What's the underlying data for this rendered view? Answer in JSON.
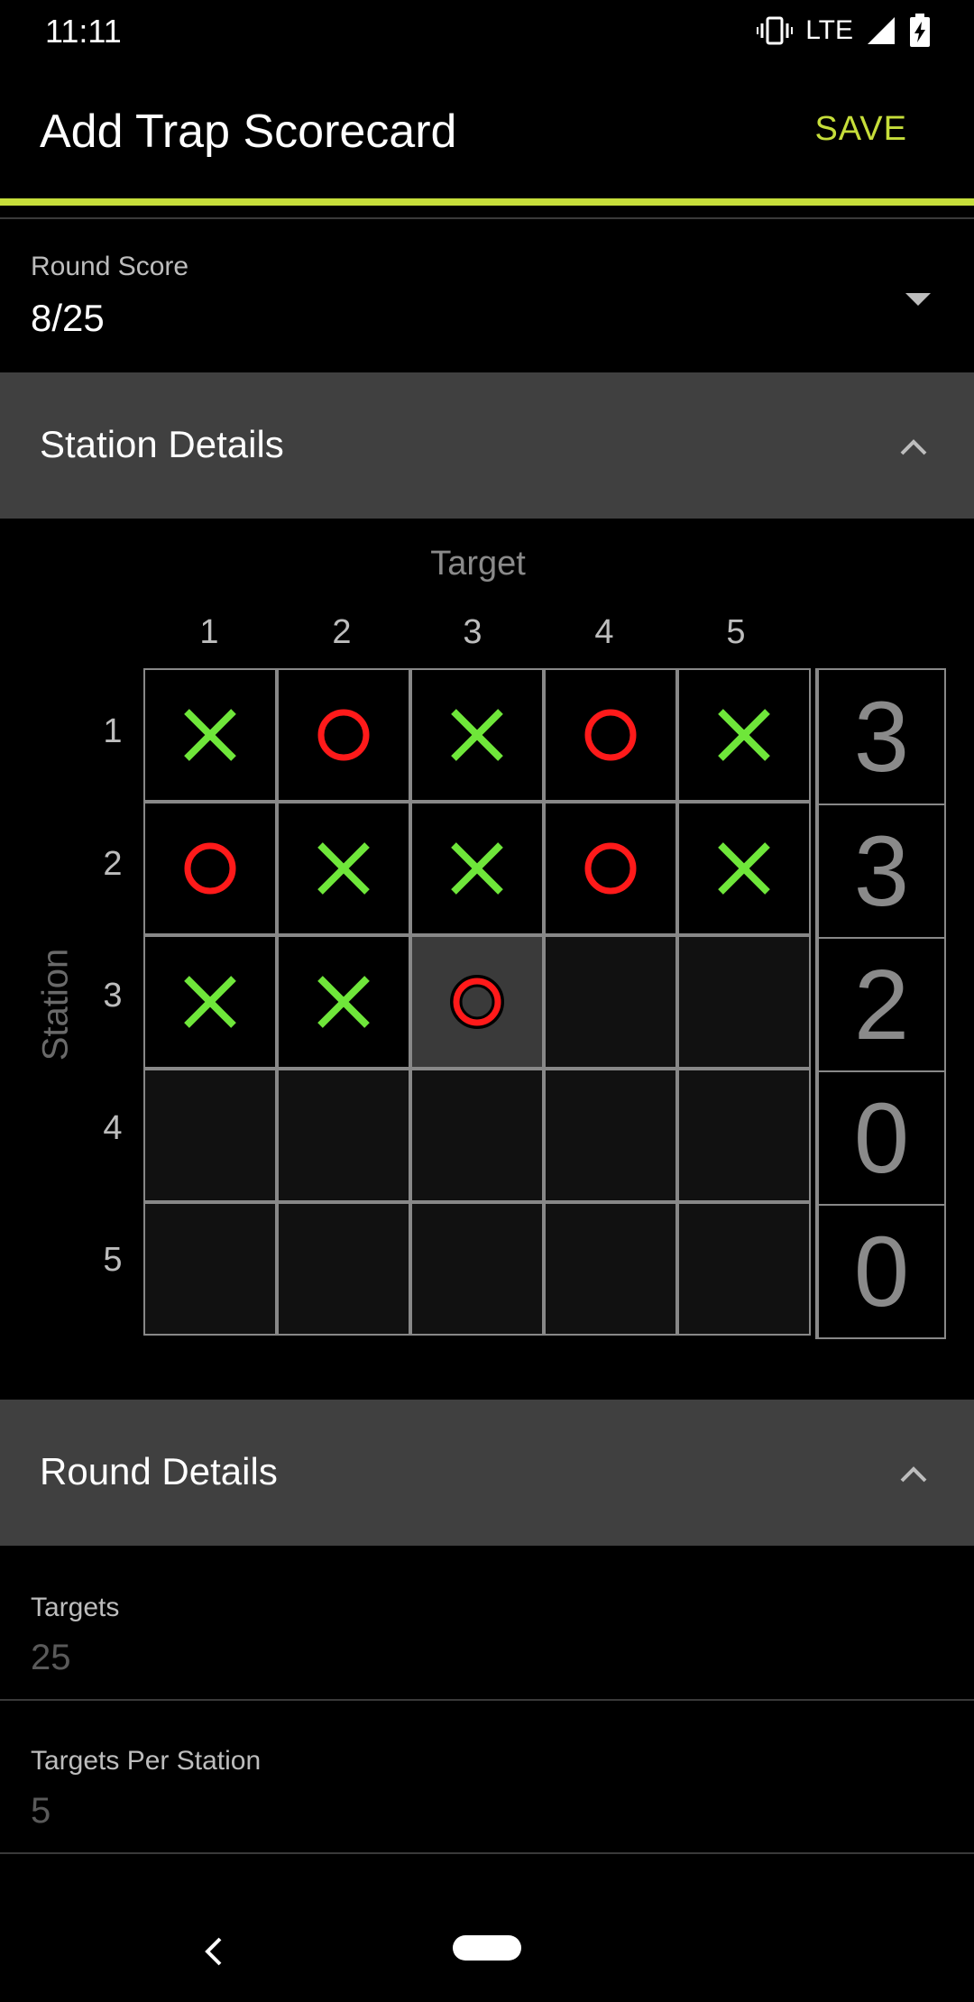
{
  "status_bar": {
    "time": "11:11",
    "network": "LTE"
  },
  "app_bar": {
    "title": "Add Trap Scorecard",
    "save_label": "SAVE"
  },
  "round_score": {
    "label": "Round Score",
    "value": "8/25"
  },
  "station_details": {
    "title": "Station Details",
    "target_axis_label": "Target",
    "station_axis_label": "Station",
    "columns": [
      "1",
      "2",
      "3",
      "4",
      "5"
    ],
    "rows": [
      "1",
      "2",
      "3",
      "4",
      "5"
    ],
    "grid": [
      [
        "hit",
        "miss",
        "hit",
        "miss",
        "hit"
      ],
      [
        "miss",
        "hit",
        "hit",
        "miss",
        "hit"
      ],
      [
        "hit",
        "hit",
        "current-miss",
        "empty",
        "empty"
      ],
      [
        "empty",
        "empty",
        "empty",
        "empty",
        "empty"
      ],
      [
        "empty",
        "empty",
        "empty",
        "empty",
        "empty"
      ]
    ],
    "totals": [
      "3",
      "3",
      "2",
      "0",
      "0"
    ]
  },
  "round_details": {
    "title": "Round Details",
    "fields": [
      {
        "label": "Targets",
        "value": "25"
      },
      {
        "label": "Targets Per Station",
        "value": "5"
      }
    ]
  },
  "colors": {
    "accent": "#c6de3a",
    "hit": "#6fe63a",
    "miss": "#ff1a1a",
    "header_bg": "#404040"
  },
  "icons": {
    "hit": "x-mark-icon",
    "miss": "circle-icon",
    "collapse": "chevron-up-icon",
    "expand": "dropdown-arrow-icon"
  }
}
